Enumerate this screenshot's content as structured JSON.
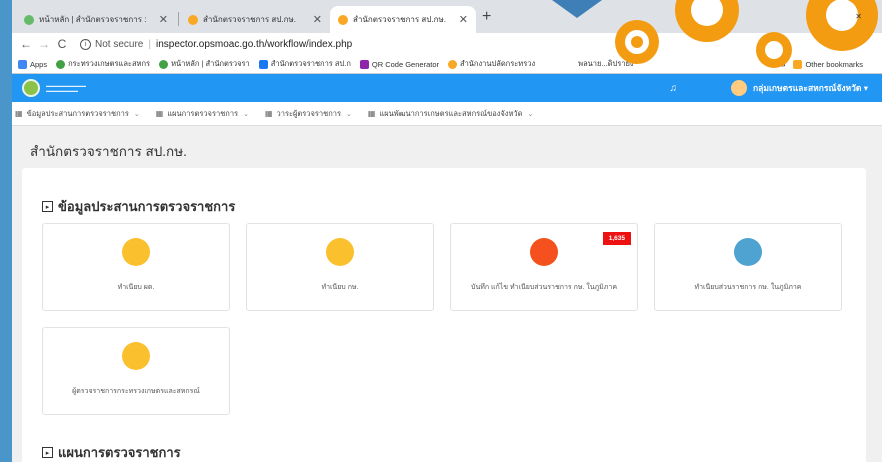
{
  "tabs": [
    {
      "title": "หน้าหลัก | สำนักตรวจราชการ :"
    },
    {
      "title": "สำนักตรวจราชการ สป.กษ."
    },
    {
      "title": "สำนักตรวจราชการ สป.กษ."
    }
  ],
  "new_tab_label": "+",
  "address": {
    "security": "Not secure",
    "url": "inspector.opsmoac.go.th/workflow/index.php"
  },
  "bookmarks": [
    {
      "label": "Apps",
      "color": "#4285f4"
    },
    {
      "label": "กระทรวงเกษตรและสหกร",
      "color": "#43a047"
    },
    {
      "label": "หน้าหลัก | สำนักตรวจรา",
      "color": "#43a047"
    },
    {
      "label": "สำนักตรวจราชการ สป.ก",
      "color": "#1877f2"
    },
    {
      "label": "QR Code Generator",
      "color": "#8e24aa"
    },
    {
      "label": "สำนักงานปลัดกระทรวง",
      "color": "#f9a825"
    },
    {
      "label": "พลนาย...ดิปรายง",
      "color": "#bdbdbd"
    }
  ],
  "bookmarks_more": "»",
  "other_bookmarks": "Other bookmarks",
  "header": {
    "user_name": "กลุ่มเกษตรและสหกรณ์จังหวัด ▾"
  },
  "nav": [
    {
      "label": "ข้อมูลประสานการตรวจราชการ"
    },
    {
      "label": "แผนการตรวจราชการ"
    },
    {
      "label": "วาระผู้ตรวจราชการ"
    },
    {
      "label": "แผนพัฒนาการเกษตรและสหกรณ์ของจังหวัด"
    }
  ],
  "page_title": "สำนักตรวจราชการ สป.กษ.",
  "section1": {
    "title": "ข้อมูลประสานการตรวจราชการ",
    "tiles": [
      {
        "label": "ทำเนียบ ผต.",
        "icon": "people-icon",
        "color": "#fbc02d"
      },
      {
        "label": "ทำเนียบ กษ.",
        "icon": "people-icon",
        "color": "#fbc02d"
      },
      {
        "label": "บันทึก แก้ไข ทำเนียบส่วนราชการ กษ. ในภูมิภาค",
        "icon": "edit-document-icon",
        "color": "#f4511e",
        "badge": "1,635"
      },
      {
        "label": "ทำเนียบส่วนราชการ กษ. ในภูมิภาค",
        "icon": "book-icon",
        "color": "#4fa3d1"
      },
      {
        "label": "ผู้ตรวจราชการกระทรวงเกษตรและสหกรณ์",
        "icon": "people-icon",
        "color": "#fbc02d"
      }
    ]
  },
  "section2": {
    "title": "แผนการตรวจราชการ"
  }
}
